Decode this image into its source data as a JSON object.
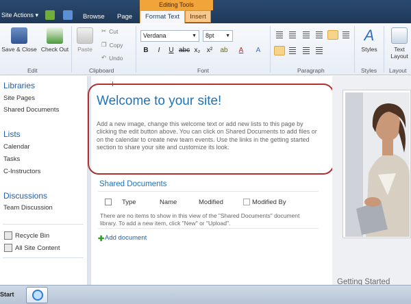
{
  "topbar": {
    "site_actions": "Site Actions ▾",
    "tabs": {
      "browse": "Browse",
      "page": "Page"
    },
    "editing_tools": "Editing Tools",
    "format_text": "Format Text",
    "insert": "Insert"
  },
  "ribbon": {
    "edit": {
      "save_close": "Save & Close",
      "check_out": "Check Out",
      "label": "Edit"
    },
    "clipboard": {
      "paste": "Paste",
      "cut": "Cut",
      "copy": "Copy",
      "undo": "Undo",
      "label": "Clipboard"
    },
    "font": {
      "family": "Verdana",
      "size": "8pt",
      "label": "Font"
    },
    "paragraph": {
      "label": "Paragraph"
    },
    "styles": {
      "button": "Styles",
      "label": "Styles"
    },
    "layout": {
      "button": "Text Layout",
      "label": "Layout"
    }
  },
  "leftnav": {
    "libraries": "Libraries",
    "site_pages": "Site Pages",
    "shared_documents": "Shared Documents",
    "lists": "Lists",
    "calendar": "Calendar",
    "tasks": "Tasks",
    "c_instructors": "C-Instructors",
    "discussions": "Discussions",
    "team_discussion": "Team Discussion",
    "recycle_bin": "Recycle Bin",
    "all_site_content": "All Site Content"
  },
  "main": {
    "title": "Welcome to your site!",
    "body": "Add a new image, change this welcome text or add new lists to this page by clicking the edit button above. You can click on Shared Documents to add files or on the calendar to create new team events. Use the links in the getting started section to share your site and customize its look.",
    "shared_docs": {
      "title": "Shared Documents",
      "columns": {
        "type": "Type",
        "name": "Name",
        "modified": "Modified",
        "modified_by": "Modified By"
      },
      "empty": "There are no items to show in this view of the \"Shared Documents\" document library. To add a new item, click \"New\" or \"Upload\".",
      "add": "Add document"
    }
  },
  "right": {
    "getting_started": "Getting Started"
  },
  "taskbar": {
    "start": "Start"
  },
  "colors": {
    "accent": "#1e72b8",
    "highlight": "#b0302e",
    "tab_orange": "#f0a43a"
  }
}
